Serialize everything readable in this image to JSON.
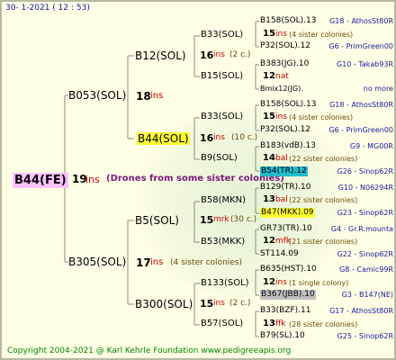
{
  "header": "30-   1-2021  ( 12 : 53)",
  "root": "B44(FE)",
  "gen1": {
    "num": "19",
    "ins": "ins",
    "note": "(Drones from some sister colonies)"
  },
  "sire": "B053(SOL)",
  "dam": "B305(SOL)",
  "sire_num": "18",
  "sire_ins": "ins",
  "dam_num": "17",
  "dam_ins": "ins",
  "dam_note": "(4 sister colonies)",
  "b12": "B12(SOL)",
  "b12_num": "16",
  "b12_ins": "ins",
  "b12_note": "(2 c.)",
  "b44": "B44(SOL)",
  "b44_num": "16",
  "b44_ins": "ins",
  "b44_note": "(10 c.)",
  "b5": "B5(SOL)",
  "b5_num": "15",
  "b5_ins": "mrk",
  "b5_note": "(30 c.)",
  "b300": "B300(SOL)",
  "b300_num": "15",
  "b300_ins": "ins",
  "b300_note": "(2 c.)",
  "g3": [
    {
      "name": "B33(SOL)"
    },
    {
      "name": "B15(SOL)"
    },
    {
      "name": "B33(SOL)"
    },
    {
      "name": "B9(SOL)"
    },
    {
      "name": "B58(MKN)"
    },
    {
      "name": "B53(MKK)"
    },
    {
      "name": "B133(SOL)"
    },
    {
      "name": "B57(SOL)"
    }
  ],
  "g3_info": [
    {
      "num": "15",
      "ins": "ins",
      "note": "(4 sister colonies)"
    },
    {
      "num": "12",
      "ins": "nat",
      "note": ""
    },
    {
      "num": "15",
      "ins": "ins",
      "note": "(4 sister colonies)"
    },
    {
      "num": "14",
      "ins": "bal",
      "note": "(22 sister colonies)"
    },
    {
      "num": "13",
      "ins": "bal",
      "note": "(22 sister colonies)"
    },
    {
      "num": "12",
      "ins": "mfk",
      "note": "(21 sister colonies)"
    },
    {
      "num": "12",
      "ins": "ins",
      "note": "(1 single colony)"
    },
    {
      "num": "13",
      "ins": "ffk",
      "note": "(28 sister colonies)"
    }
  ],
  "g4": [
    {
      "left": "B158(SOL).13",
      "right": "G18 - AthosSt80R"
    },
    {
      "left": "P32(SOL).12",
      "right": "G6 - PrimGreen00"
    },
    {
      "left": "B383(JG).10",
      "right": "G10 - Takab93R"
    },
    {
      "left": "Bmix12(JG).",
      "right": "no more"
    },
    {
      "left": "B158(SOL).13",
      "right": "G18 - AthosSt80R"
    },
    {
      "left": "P32(SOL).12",
      "right": "G6 - PrimGreen00"
    },
    {
      "left": "B183(vdB).13",
      "right": "G9 - MG00R"
    },
    {
      "left": "B54(TR).12",
      "right": "G26 - Sinop62R"
    },
    {
      "left": "B129(TR).10",
      "right": "G10 - N06294R"
    },
    {
      "left": "B47(MKK).09",
      "right": "G23 - Sinop62R"
    },
    {
      "left": "GR73(TR).10",
      "right": "G4 - Gr.R.mounta"
    },
    {
      "left": "ST114.09",
      "right": "G22 - Sinop62R"
    },
    {
      "left": "B635(HST).10",
      "right": "G8 - Camic99R"
    },
    {
      "left": "B367(JBB).10",
      "right": "G3 - B147(NE)"
    },
    {
      "left": "B33(BZF).11",
      "right": "G17 - AthosSt80R"
    },
    {
      "left": "B79(SL).10",
      "right": "G25 - Sinop62R"
    }
  ],
  "footer": "Copyright 2004-2021 @ Karl Kehrle Foundation    www.pedigreeapis.org"
}
